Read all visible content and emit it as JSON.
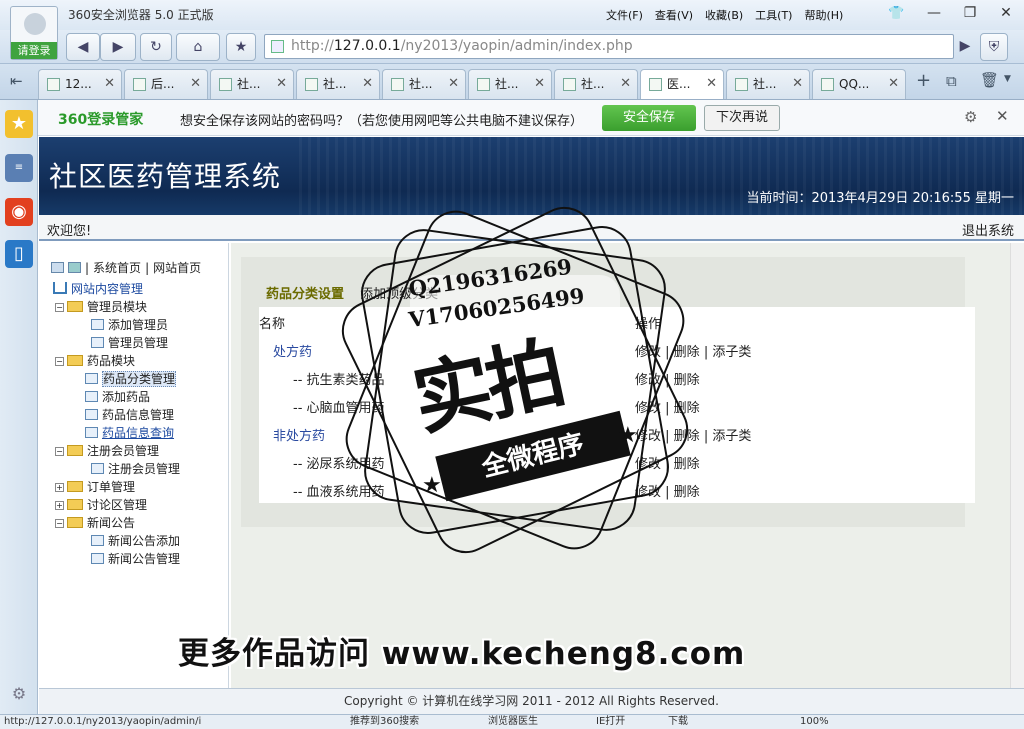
{
  "browser": {
    "title": "360安全浏览器 5.0 正式版",
    "login_label": "请登录",
    "menu": [
      "文件(F)",
      "查看(V)",
      "收藏(B)",
      "工具(T)",
      "帮助(H)"
    ],
    "window_buttons": [
      "—",
      "❐",
      "✕"
    ],
    "address_prefix": "http://",
    "address_host": "127.0.0.1",
    "address_path": "/ny2013/yaopin/admin/index.php",
    "tabs": [
      {
        "label": "12..."
      },
      {
        "label": "后..."
      },
      {
        "label": "社..."
      },
      {
        "label": "社..."
      },
      {
        "label": "社..."
      },
      {
        "label": "社..."
      },
      {
        "label": "社..."
      },
      {
        "label": "医..."
      },
      {
        "label": "社..."
      },
      {
        "label": "QQ..."
      }
    ],
    "active_tab_index": 7
  },
  "password_bar": {
    "brand": "360登录管家",
    "prompt": "想安全保存该网站的密码吗？（若您使用网吧等公共电脑不建议保存）",
    "save_label": "安全保存",
    "later_label": "下次再说"
  },
  "page": {
    "system_title": "社区医药管理系统",
    "current_time": "当前时间：2013年4月29日  20:16:55 星期一",
    "welcome": "欢迎您!",
    "logout": "退出系统",
    "footer": "Copyright © 计算机在线学习网  2011 - 2012 All Rights Reserved."
  },
  "leftnav": {
    "top_links": [
      "系统首页",
      "网站首页"
    ],
    "root_label": "网站内容管理",
    "items": [
      {
        "label": "管理员模块",
        "type": "folder"
      },
      {
        "label": "添加管理员",
        "type": "page"
      },
      {
        "label": "管理员管理",
        "type": "page"
      },
      {
        "label": "药品模块",
        "type": "folder"
      },
      {
        "label": "药品分类管理",
        "type": "page"
      },
      {
        "label": "添加药品",
        "type": "page"
      },
      {
        "label": "药品信息管理",
        "type": "page"
      },
      {
        "label": "药品信息查询",
        "type": "page"
      },
      {
        "label": "注册会员管理",
        "type": "folder"
      },
      {
        "label": "注册会员管理",
        "type": "page"
      },
      {
        "label": "订单管理",
        "type": "folder"
      },
      {
        "label": "讨论区管理",
        "type": "folder"
      },
      {
        "label": "新闻公告",
        "type": "folder"
      },
      {
        "label": "新闻公告添加",
        "type": "page"
      },
      {
        "label": "新闻公告管理",
        "type": "page"
      }
    ]
  },
  "content": {
    "crumb_current": "药品分类设置",
    "crumb_action": "添加顶级分类",
    "header_name": "名称",
    "header_ops": "操作",
    "rows": [
      {
        "name": "处方药",
        "level": 0,
        "ops": [
          "修改",
          "删除",
          "添子类"
        ]
      },
      {
        "name": "-- 抗生素类药品",
        "level": 1,
        "ops": [
          "修改",
          "删除"
        ]
      },
      {
        "name": "-- 心脑血管用药",
        "level": 1,
        "ops": [
          "修改",
          "删除"
        ]
      },
      {
        "name": "非处方药",
        "level": 0,
        "ops": [
          "修改",
          "删除",
          "添子类"
        ]
      },
      {
        "name": "-- 泌尿系统用药",
        "level": 1,
        "ops": [
          "修改",
          "删除"
        ]
      },
      {
        "name": "-- 血液系统用药",
        "level": 1,
        "ops": [
          "修改",
          "删除"
        ]
      }
    ]
  },
  "statusbar": {
    "url": "http://127.0.0.1/ny2013/yaopin/admin/i",
    "items": [
      "推荐到360搜索",
      "浏览器医生",
      "IE打开",
      "下载",
      "100%"
    ]
  },
  "watermark": {
    "qq": "Q2196316269",
    "v": "V17060256499",
    "big": "实拍",
    "ribbon": "全微程序",
    "promo": "更多作品访问 www.kecheng8.com"
  }
}
